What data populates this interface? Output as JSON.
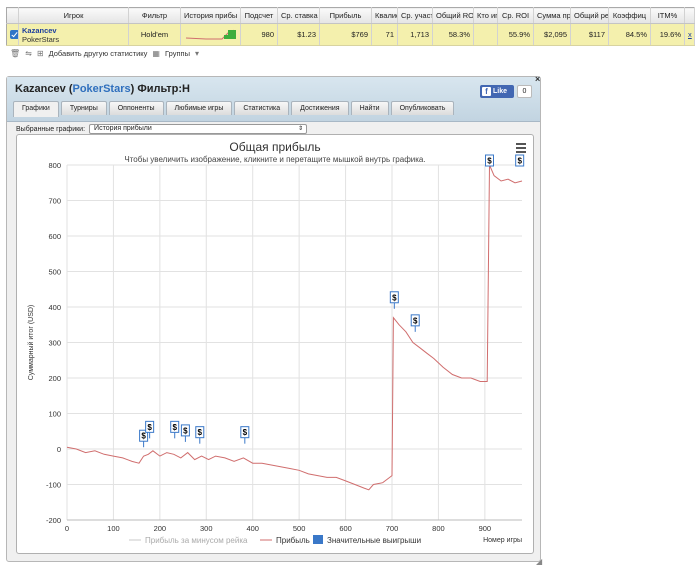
{
  "table": {
    "headers": [
      "Игрок",
      "Фильтр",
      "История прибы",
      "Подсчет",
      "Ср. ставка",
      "Прибыль",
      "Квалиф",
      "Ср. участ",
      "Общий RO",
      "Кто иг",
      "Ср. ROI",
      "Сумма пр",
      "Общий рей",
      "Коэффиц",
      "ITM%"
    ],
    "row": {
      "player_name": "Kazancev",
      "player_site": "PokerStars",
      "game": "Hold'em",
      "count": "980",
      "avg_stake": "$1.23",
      "profit": "$769",
      "qualif": "71",
      "avg_part": "1,713",
      "total_ro": "58.3%",
      "who_played": "",
      "avg_roi": "55.9%",
      "sum_pr": "$2,095",
      "total_rake": "$117",
      "coef": "84.5%",
      "itm": "19.6%",
      "remove": "x"
    }
  },
  "toolbar": {
    "add_stats": "Добавить другую статистику",
    "groups": "Группы"
  },
  "panel": {
    "title_player": "Kazancev",
    "title_site": "PokerStars",
    "title_filter": "Фильтр:Н",
    "like_label": "Like",
    "like_count": "0",
    "close": "×",
    "tabs": [
      "Графики",
      "Турниры",
      "Оппоненты",
      "Любимые игры",
      "Статистика",
      "Достижения",
      "Найти",
      "Опубликовать"
    ],
    "selected_label": "Выбранные графики:",
    "selected_value": "История прибыли"
  },
  "colors": {
    "row_highlight": "#f4f0ad",
    "profit_line": "#d06e6e",
    "rake_line": "#c8c8c8",
    "flag_color": "#3a78c8"
  },
  "chart_data": {
    "type": "line",
    "title": "Общая прибыль",
    "subtitle": "Чтобы увеличить изображение, кликните и перетащите мышкой внутрь графика.",
    "xlabel": "Номер игры",
    "ylabel": "Суммарный итог (USD)",
    "xlim": [
      0,
      980
    ],
    "ylim": [
      -200,
      800
    ],
    "xticks": [
      0,
      100,
      200,
      300,
      400,
      500,
      600,
      700,
      800,
      900
    ],
    "yticks": [
      -200,
      -100,
      0,
      100,
      200,
      300,
      400,
      500,
      600,
      700,
      800
    ],
    "grid": true,
    "legend_position": "bottom",
    "series": [
      {
        "name": "Прибыль за минусом рейка",
        "points": []
      },
      {
        "name": "Прибыль",
        "points": [
          [
            0,
            5
          ],
          [
            20,
            0
          ],
          [
            40,
            -10
          ],
          [
            60,
            -5
          ],
          [
            80,
            -15
          ],
          [
            100,
            -20
          ],
          [
            120,
            -25
          ],
          [
            140,
            -35
          ],
          [
            155,
            -40
          ],
          [
            165,
            -20
          ],
          [
            175,
            -15
          ],
          [
            185,
            -5
          ],
          [
            200,
            -20
          ],
          [
            215,
            -10
          ],
          [
            230,
            -15
          ],
          [
            245,
            -25
          ],
          [
            260,
            -10
          ],
          [
            275,
            -30
          ],
          [
            290,
            -20
          ],
          [
            305,
            -30
          ],
          [
            320,
            -20
          ],
          [
            340,
            -25
          ],
          [
            360,
            -35
          ],
          [
            380,
            -25
          ],
          [
            400,
            -40
          ],
          [
            420,
            -40
          ],
          [
            440,
            -45
          ],
          [
            460,
            -50
          ],
          [
            480,
            -55
          ],
          [
            500,
            -60
          ],
          [
            520,
            -70
          ],
          [
            540,
            -75
          ],
          [
            560,
            -80
          ],
          [
            580,
            -80
          ],
          [
            600,
            -90
          ],
          [
            620,
            -100
          ],
          [
            640,
            -110
          ],
          [
            650,
            -115
          ],
          [
            660,
            -100
          ],
          [
            680,
            -95
          ],
          [
            695,
            -80
          ],
          [
            700,
            -75
          ],
          [
            703,
            370
          ],
          [
            715,
            350
          ],
          [
            730,
            330
          ],
          [
            745,
            300
          ],
          [
            760,
            285
          ],
          [
            775,
            270
          ],
          [
            790,
            255
          ],
          [
            810,
            230
          ],
          [
            830,
            210
          ],
          [
            850,
            200
          ],
          [
            870,
            200
          ],
          [
            890,
            190
          ],
          [
            905,
            190
          ],
          [
            910,
            800
          ],
          [
            920,
            770
          ],
          [
            935,
            755
          ],
          [
            950,
            760
          ],
          [
            965,
            750
          ],
          [
            980,
            755
          ]
        ]
      },
      {
        "name": "Значительные выигрыши",
        "flag_label": "$",
        "points": [
          [
            165,
            5
          ],
          [
            178,
            30
          ],
          [
            232,
            30
          ],
          [
            255,
            20
          ],
          [
            286,
            15
          ],
          [
            383,
            15
          ],
          [
            705,
            395
          ],
          [
            750,
            330
          ],
          [
            910,
            800
          ],
          [
            975,
            800
          ]
        ]
      }
    ]
  }
}
